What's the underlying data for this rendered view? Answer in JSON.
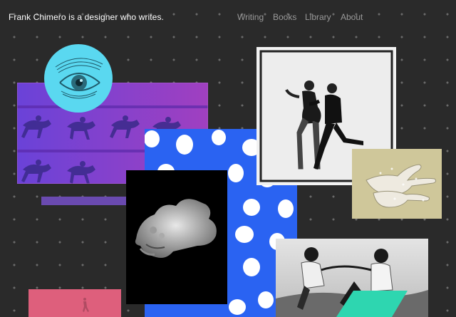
{
  "header": {
    "site_title": "Frank Chimero is a designer who writes.",
    "nav": [
      {
        "label": "Writing"
      },
      {
        "label": "Books"
      },
      {
        "label": "Library"
      },
      {
        "label": "About"
      }
    ]
  },
  "colors": {
    "background": "#2a2a2a",
    "dot": "#6a6a6a",
    "eye_circle": "#5ad8f0",
    "horse_panel": "#8a3fc2",
    "polka_blue": "#2a63f2",
    "purple_bar": "#6a4ab0",
    "pink_panel": "#e0607e",
    "teal_shape": "#2ed6b0"
  },
  "artworks": [
    {
      "name": "eye-engraving"
    },
    {
      "name": "horse-motion-panel"
    },
    {
      "name": "dancing-couple-photo"
    },
    {
      "name": "hands-photo"
    },
    {
      "name": "polka-dot-panel"
    },
    {
      "name": "bust-sculpture-photo"
    },
    {
      "name": "fighting-women-photo"
    },
    {
      "name": "pink-runner-panel"
    }
  ]
}
